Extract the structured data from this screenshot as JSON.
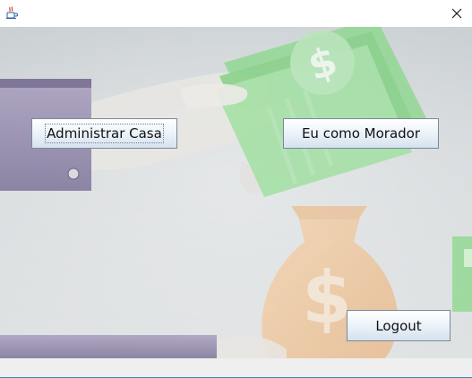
{
  "window": {
    "title": "",
    "app_icon": "java-coffee-cup-icon",
    "close_glyph": "✕"
  },
  "buttons": {
    "admin_label": "Administrar Casa",
    "morador_label": "Eu como Morador",
    "logout_label": "Logout"
  },
  "colors": {
    "button_border": "#7a8a99",
    "money_green": "#7fd07f",
    "money_bag": "#f0c79a",
    "sleeve_purple": "#8f86a8",
    "accent_line": "#2e8fa8"
  }
}
